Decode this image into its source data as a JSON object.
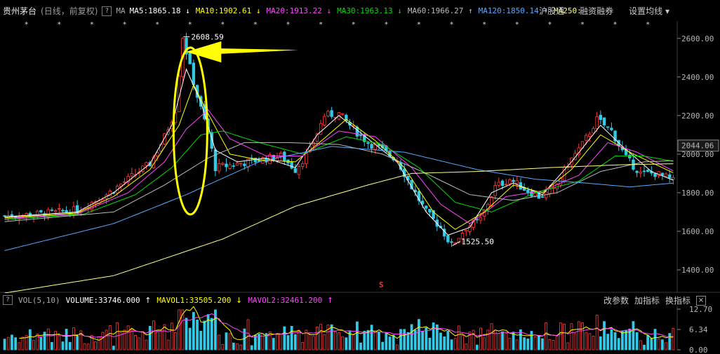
{
  "header": {
    "stock_name": "贵州茅台",
    "period_label": "(日线，前复权)",
    "help_label": "?",
    "ma_label": "MA",
    "ma_items": [
      {
        "label": "MA5:1865.18",
        "arrow": "↓",
        "color": "#ffffff"
      },
      {
        "label": "MA10:1902.61",
        "arrow": "↓",
        "color": "#ffff00"
      },
      {
        "label": "MA20:1913.22",
        "arrow": "↓",
        "color": "#ff44ff"
      },
      {
        "label": "MA30:1963.13",
        "arrow": "↓",
        "color": "#00dd00"
      },
      {
        "label": "MA60:1966.27",
        "arrow": "↑",
        "color": "#bbbbbb"
      },
      {
        "label": "MA120:1850.14",
        "arrow": "↑",
        "color": "#55aaff"
      },
      {
        "label": "MA250:",
        "arrow": "",
        "color": "#ffff88"
      }
    ],
    "links": [
      "沪股通",
      "融资融券",
      "设置均线 ▾"
    ]
  },
  "volume": {
    "help_label": "?",
    "title": "VOL(5,10)",
    "volume_label": "VOLUME:33746.000",
    "vol_arrow": "↑",
    "mavol1_label": "MAVOL1:33505.200",
    "mavol1_arrow": "↓",
    "mavol2_label": "MAVOL2:32461.200",
    "mavol2_arrow": "↑",
    "links": [
      "改参数",
      "加指标",
      "换指标"
    ],
    "close_label": "×"
  },
  "colors": {
    "up": "#ff3c3c",
    "down": "#32c8e6",
    "ma5": "#ffffff",
    "ma10": "#ffff00",
    "ma20": "#ff44ff",
    "ma30": "#00dd00",
    "ma60": "#bbbbbb",
    "ma120": "#55aaff",
    "ma250": "#ffff88",
    "annotation": "#ffff00"
  },
  "chart_data": {
    "type": "candlestick",
    "y_ticks": [
      "2600.00",
      "2400.00",
      "2200.00",
      "2000.00",
      "1800.00",
      "1600.00",
      "1400.00"
    ],
    "ylim": [
      1280,
      2690
    ],
    "current_price_label": "2044.06",
    "current_price": 2044.06,
    "high_label": "2608.59",
    "high_value": 2608.59,
    "low_label": "1525.50",
    "low_value": 1525.5,
    "marker_label": "S",
    "price_path": [
      [
        0,
        1680
      ],
      [
        10,
        1690
      ],
      [
        20,
        1710
      ],
      [
        28,
        1790
      ],
      [
        34,
        1870
      ],
      [
        40,
        1950
      ],
      [
        44,
        2090
      ],
      [
        47,
        2230
      ],
      [
        49,
        2608.59
      ],
      [
        51,
        2450
      ],
      [
        53,
        2300
      ],
      [
        56,
        2110
      ],
      [
        58,
        1930
      ],
      [
        64,
        1950
      ],
      [
        70,
        1970
      ],
      [
        76,
        1990
      ],
      [
        80,
        1920
      ],
      [
        84,
        2020
      ],
      [
        88,
        2200
      ],
      [
        92,
        2210
      ],
      [
        96,
        2130
      ],
      [
        100,
        2060
      ],
      [
        104,
        2020
      ],
      [
        108,
        1970
      ],
      [
        112,
        1830
      ],
      [
        116,
        1700
      ],
      [
        120,
        1620
      ],
      [
        123,
        1525.5
      ],
      [
        127,
        1620
      ],
      [
        131,
        1660
      ],
      [
        135,
        1830
      ],
      [
        139,
        1870
      ],
      [
        143,
        1820
      ],
      [
        147,
        1780
      ],
      [
        151,
        1810
      ],
      [
        155,
        1950
      ],
      [
        159,
        2050
      ],
      [
        163,
        2180
      ],
      [
        167,
        2120
      ],
      [
        171,
        1980
      ],
      [
        175,
        1900
      ],
      [
        179,
        1900
      ],
      [
        182,
        1880
      ],
      [
        184,
        1860
      ]
    ],
    "vol_ticks": [
      "12.70",
      "6.34",
      "0.00"
    ],
    "vol_ylim": [
      0,
      12.7
    ],
    "ma": {
      "ma5": [
        [
          0,
          1675
        ],
        [
          20,
          1700
        ],
        [
          30,
          1800
        ],
        [
          40,
          1950
        ],
        [
          46,
          2150
        ],
        [
          50,
          2440
        ],
        [
          54,
          2270
        ],
        [
          58,
          2020
        ],
        [
          64,
          1960
        ],
        [
          72,
          1980
        ],
        [
          80,
          1930
        ],
        [
          86,
          2100
        ],
        [
          92,
          2200
        ],
        [
          100,
          2080
        ],
        [
          108,
          1960
        ],
        [
          116,
          1700
        ],
        [
          122,
          1580
        ],
        [
          128,
          1620
        ],
        [
          134,
          1800
        ],
        [
          140,
          1850
        ],
        [
          148,
          1790
        ],
        [
          156,
          1960
        ],
        [
          164,
          2150
        ],
        [
          170,
          2040
        ],
        [
          178,
          1910
        ],
        [
          184,
          1865
        ]
      ],
      "ma10": [
        [
          0,
          1670
        ],
        [
          20,
          1695
        ],
        [
          30,
          1780
        ],
        [
          40,
          1920
        ],
        [
          48,
          2150
        ],
        [
          52,
          2360
        ],
        [
          56,
          2210
        ],
        [
          62,
          2000
        ],
        [
          70,
          1970
        ],
        [
          80,
          1960
        ],
        [
          86,
          2050
        ],
        [
          94,
          2180
        ],
        [
          102,
          2070
        ],
        [
          110,
          1930
        ],
        [
          118,
          1700
        ],
        [
          124,
          1610
        ],
        [
          132,
          1700
        ],
        [
          140,
          1840
        ],
        [
          148,
          1800
        ],
        [
          156,
          1920
        ],
        [
          164,
          2100
        ],
        [
          172,
          2010
        ],
        [
          184,
          1903
        ]
      ],
      "ma20": [
        [
          0,
          1665
        ],
        [
          20,
          1690
        ],
        [
          34,
          1800
        ],
        [
          44,
          1960
        ],
        [
          50,
          2130
        ],
        [
          56,
          2230
        ],
        [
          62,
          2080
        ],
        [
          72,
          1990
        ],
        [
          82,
          1990
        ],
        [
          92,
          2120
        ],
        [
          102,
          2090
        ],
        [
          112,
          1930
        ],
        [
          120,
          1740
        ],
        [
          128,
          1640
        ],
        [
          138,
          1780
        ],
        [
          148,
          1810
        ],
        [
          158,
          1890
        ],
        [
          166,
          2060
        ],
        [
          174,
          2010
        ],
        [
          184,
          1913
        ]
      ],
      "ma30": [
        [
          0,
          1660
        ],
        [
          22,
          1690
        ],
        [
          36,
          1790
        ],
        [
          46,
          1930
        ],
        [
          54,
          2100
        ],
        [
          60,
          2120
        ],
        [
          70,
          2060
        ],
        [
          82,
          2000
        ],
        [
          94,
          2090
        ],
        [
          104,
          2050
        ],
        [
          114,
          1930
        ],
        [
          124,
          1750
        ],
        [
          134,
          1700
        ],
        [
          146,
          1800
        ],
        [
          158,
          1860
        ],
        [
          168,
          1990
        ],
        [
          176,
          1990
        ],
        [
          184,
          1963
        ]
      ],
      "ma60": [
        [
          0,
          1650
        ],
        [
          30,
          1700
        ],
        [
          44,
          1840
        ],
        [
          56,
          1980
        ],
        [
          66,
          2060
        ],
        [
          78,
          2060
        ],
        [
          92,
          2050
        ],
        [
          104,
          2000
        ],
        [
          116,
          1900
        ],
        [
          128,
          1790
        ],
        [
          140,
          1760
        ],
        [
          152,
          1800
        ],
        [
          164,
          1910
        ],
        [
          176,
          1960
        ],
        [
          184,
          1966
        ]
      ],
      "ma120": [
        [
          0,
          1500
        ],
        [
          30,
          1640
        ],
        [
          50,
          1790
        ],
        [
          70,
          1960
        ],
        [
          90,
          2040
        ],
        [
          110,
          2010
        ],
        [
          130,
          1920
        ],
        [
          146,
          1870
        ],
        [
          160,
          1850
        ],
        [
          172,
          1830
        ],
        [
          184,
          1850
        ]
      ],
      "ma250": [
        [
          0,
          1280
        ],
        [
          30,
          1370
        ],
        [
          60,
          1560
        ],
        [
          80,
          1730
        ],
        [
          100,
          1840
        ],
        [
          112,
          1900
        ],
        [
          130,
          1910
        ],
        [
          150,
          1930
        ],
        [
          170,
          1945
        ],
        [
          184,
          1950
        ]
      ]
    }
  }
}
